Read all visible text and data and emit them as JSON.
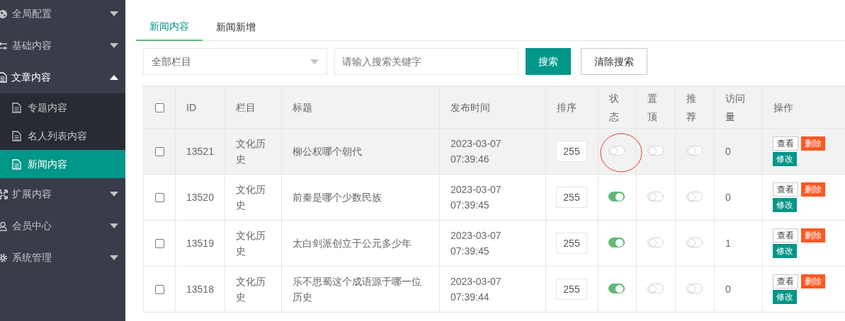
{
  "sidebar": {
    "items": [
      {
        "label": "全局配置",
        "expanded": false
      },
      {
        "label": "基础内容",
        "expanded": false
      },
      {
        "label": "文章内容",
        "expanded": true,
        "children": [
          {
            "label": "专题内容",
            "selected": false
          },
          {
            "label": "名人列表内容",
            "selected": false
          },
          {
            "label": "新闻内容",
            "selected": true
          }
        ]
      },
      {
        "label": "扩展内容",
        "expanded": false
      },
      {
        "label": "会员中心",
        "expanded": false
      },
      {
        "label": "系统管理",
        "expanded": false
      }
    ]
  },
  "tabs": [
    {
      "label": "新闻内容",
      "selected": true
    },
    {
      "label": "新闻新增",
      "selected": false
    }
  ],
  "filters": {
    "category": "全部栏目",
    "search": {
      "placeholder": "请输入搜索关键字"
    },
    "search_button": "搜索",
    "clear_button": "清除搜索"
  },
  "table": {
    "all_checked": false,
    "columns": [
      "ID",
      "栏目",
      "标题",
      "发布时间",
      "排序",
      "状态",
      "置顶",
      "推荐",
      "访问量",
      "操作"
    ],
    "rows": [
      {
        "checked": false,
        "hovered": true,
        "annotated": true,
        "id": "13521",
        "category": "文化历史",
        "title": "柳公权哪个朝代",
        "time": "2023-03-07 07:39:46",
        "order": "255",
        "status": false,
        "top": false,
        "recommend": false,
        "visits": "0",
        "actions": [
          "查看",
          "删除",
          "修改"
        ]
      },
      {
        "checked": false,
        "hovered": false,
        "annotated": false,
        "id": "13520",
        "category": "文化历史",
        "title": "前秦是哪个少数民族",
        "time": "2023-03-07 07:39:45",
        "order": "255",
        "status": true,
        "top": false,
        "recommend": false,
        "visits": "0",
        "actions": [
          "查看",
          "删除",
          "修改"
        ]
      },
      {
        "checked": false,
        "hovered": false,
        "annotated": false,
        "id": "13519",
        "category": "文化历史",
        "title": "太白剑派创立于公元多少年",
        "time": "2023-03-07 07:39:45",
        "order": "255",
        "status": true,
        "top": false,
        "recommend": false,
        "visits": "1",
        "actions": [
          "查看",
          "删除",
          "修改"
        ]
      },
      {
        "checked": false,
        "hovered": false,
        "annotated": false,
        "id": "13518",
        "category": "文化历史",
        "title": "乐不思蜀这个成语源于哪一位历史",
        "time": "2023-03-07 07:39:44",
        "order": "255",
        "status": true,
        "top": false,
        "recommend": false,
        "visits": "0",
        "actions": [
          "查看",
          "删除",
          "修改"
        ]
      }
    ]
  }
}
